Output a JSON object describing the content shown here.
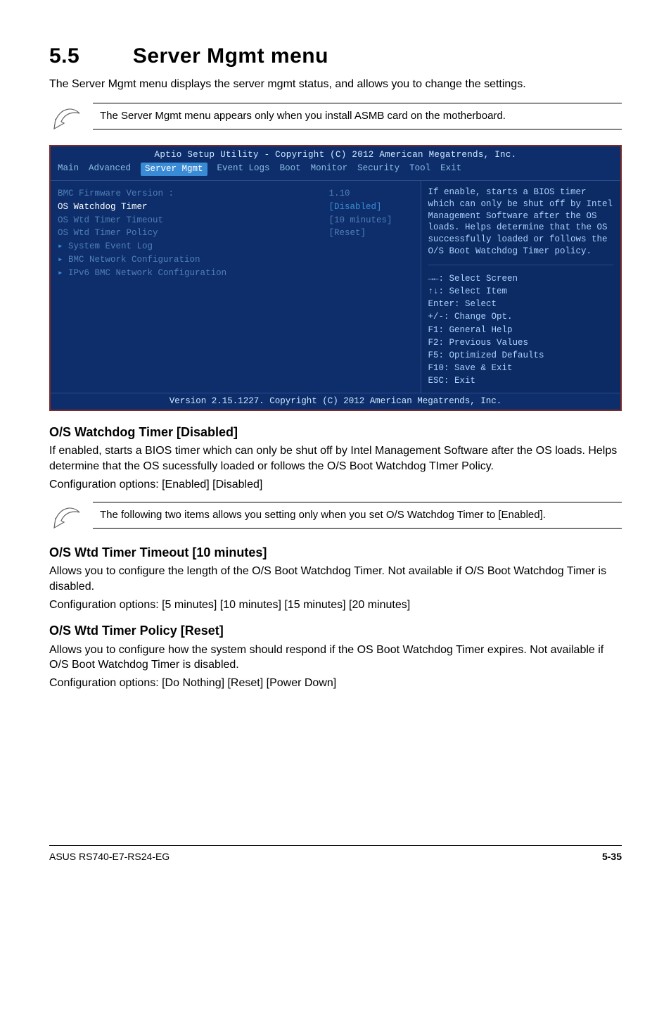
{
  "section": {
    "number": "5.5",
    "title": "Server Mgmt menu"
  },
  "intro": "The Server Mgmt menu displays the server mgmt status, and allows you to change the settings.",
  "note1": "The Server Mgmt menu appears only when you install ASMB card on the motherboard.",
  "bios": {
    "top": "Aptio Setup Utility - Copyright (C) 2012 American Megatrends, Inc.",
    "menus": [
      "Main",
      "Advanced",
      "Server Mgmt",
      "Event Logs",
      "Boot",
      "Monitor",
      "Security",
      "Tool",
      "Exit"
    ],
    "active_menu_index": 2,
    "rows": [
      {
        "label": "BMC Firmware Version :",
        "val": "1.10",
        "sel": false,
        "sub": false
      },
      {
        "label": "OS Watchdog Timer",
        "val": "[Disabled]",
        "sel": true,
        "sub": false
      },
      {
        "label": "OS Wtd Timer Timeout",
        "val": "[10 minutes]",
        "sel": false,
        "sub": false
      },
      {
        "label": "OS Wtd Timer Policy",
        "val": "[Reset]",
        "sel": false,
        "sub": false
      },
      {
        "label": "System Event Log",
        "val": "",
        "sel": false,
        "sub": true
      },
      {
        "label": "BMC Network Configuration",
        "val": "",
        "sel": false,
        "sub": true
      },
      {
        "label": "IPv6 BMC Network Configuration",
        "val": "",
        "sel": false,
        "sub": true
      }
    ],
    "help": "If enable, starts a BIOS timer which can only be shut off by Intel Management Software after the OS loads.  Helps determine that the OS successfully loaded or follows the O/S Boot Watchdog Timer policy.",
    "keys": [
      "→←: Select Screen",
      "↑↓: Select Item",
      "Enter: Select",
      "+/-: Change Opt.",
      "F1: General Help",
      "F2: Previous Values",
      "F5: Optimized Defaults",
      "F10: Save & Exit",
      "ESC: Exit"
    ],
    "footer": "Version 2.15.1227. Copyright (C) 2012 American Megatrends, Inc."
  },
  "opt1": {
    "title": "O/S Watchdog Timer [Disabled]",
    "body": "If enabled, starts a BIOS timer which can only be shut off by Intel Management Software after the OS loads. Helps determine that the OS sucessfully loaded or follows the O/S Boot Watchdog TImer Policy.",
    "config": "Configuration options: [Enabled] [Disabled]"
  },
  "note2": "The following two items allows you setting only when you set O/S Watchdog Timer to [Enabled].",
  "opt2": {
    "title": "O/S Wtd Timer Timeout [10 minutes]",
    "body": "Allows you to configure the length of the O/S Boot Watchdog Timer. Not available if O/S Boot Watchdog Timer is disabled.",
    "config": "Configuration options: [5 minutes] [10 minutes] [15 minutes] [20 minutes]"
  },
  "opt3": {
    "title": "O/S Wtd Timer Policy [Reset]",
    "body": "Allows you to configure how the system should respond if the OS Boot Watchdog Timer expires. Not available if O/S Boot Watchdog Timer is disabled.",
    "config": "Configuration options: [Do Nothing] [Reset] [Power Down]"
  },
  "footer": {
    "left": "ASUS RS740-E7-RS24-EG",
    "right": "5-35"
  }
}
